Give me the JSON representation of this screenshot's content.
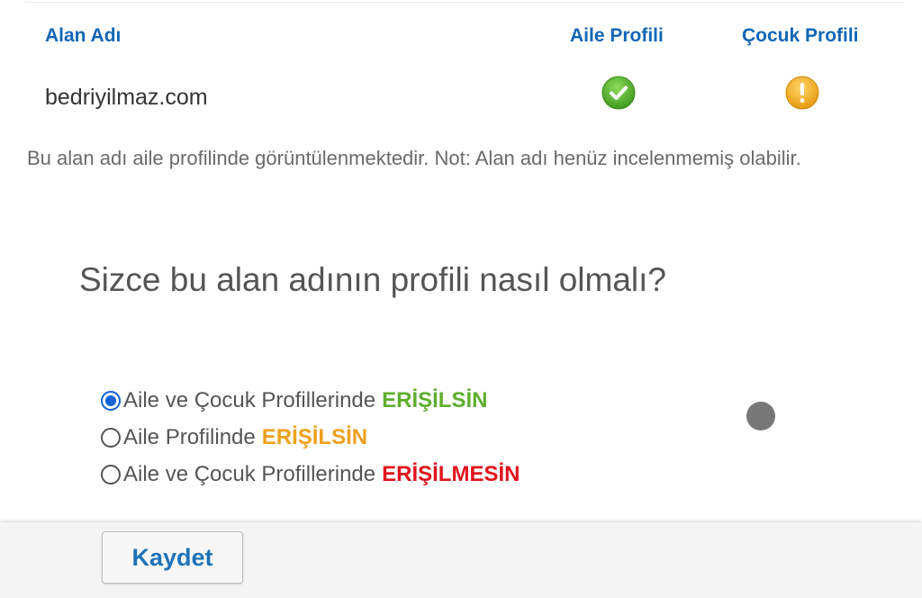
{
  "table": {
    "header_domain": "Alan Adı",
    "header_family": "Aile Profili",
    "header_child": "Çocuk Profili",
    "domain": "bedriyilmaz.com",
    "family_status_icon": "check-circle-icon",
    "child_status_icon": "warning-circle-icon",
    "family_status_color": "#5cb531",
    "child_status_color": "#f3b11e"
  },
  "note": "Bu alan adı aile profilinde görüntülenmektedir. Not: Alan adı henüz incelenmemiş olabilir.",
  "question": "Sizce bu alan adının profili nasıl olmalı?",
  "options": [
    {
      "prefix": "Aile ve Çocuk Profillerinde",
      "emphasis": "ERİŞİLSİN",
      "checked": true
    },
    {
      "prefix": "Aile Profilinde",
      "emphasis": "ERİŞİLSİN",
      "checked": false
    },
    {
      "prefix": "Aile ve Çocuk Profillerinde",
      "emphasis": "ERİŞİLMESİN",
      "checked": false
    }
  ],
  "colors": {
    "link_blue": "#1266b6",
    "radio_blue": "#0f62d6",
    "allow_green": "#5fae2e",
    "family_orange": "#f0a01c",
    "deny_red": "#e0141c"
  },
  "footer": {
    "save_label": "Kaydet"
  }
}
